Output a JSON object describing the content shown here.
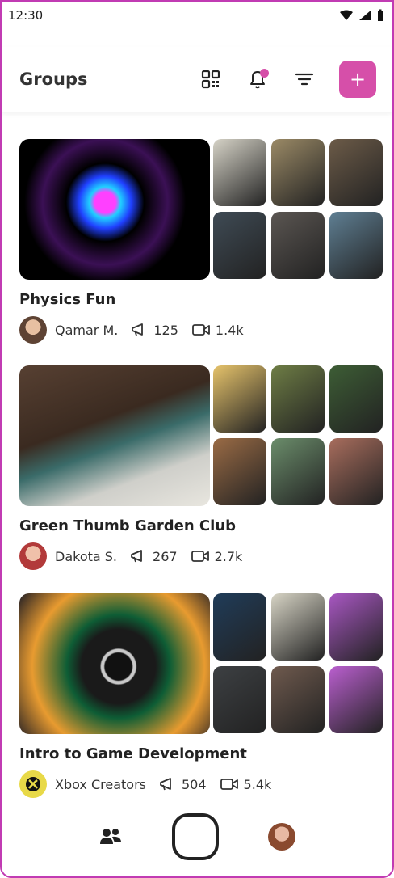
{
  "status": {
    "time": "12:30"
  },
  "header": {
    "title": "Groups",
    "add_label": "+"
  },
  "groups": [
    {
      "name": "Physics Fun",
      "owner": "Qamar M.",
      "posts": "125",
      "videos": "1.4k",
      "colors": [
        "#d6d3c7",
        "#9b8a66",
        "#6c5b48",
        "#3f4b55",
        "#5b5652",
        "#5f7f93"
      ]
    },
    {
      "name": "Green Thumb Garden Club",
      "owner": "Dakota S.",
      "posts": "267",
      "videos": "2.7k",
      "colors": [
        "#e6c36b",
        "#6e7d45",
        "#3d5d35",
        "#9a6b45",
        "#6b8d6b",
        "#a86d5d"
      ]
    },
    {
      "name": "Intro to Game Development",
      "owner": "Xbox Creators",
      "posts": "504",
      "videos": "5.4k",
      "colors": [
        "#203c59",
        "#d7d4c5",
        "#a857c2",
        "#3d4043",
        "#6f5a4e",
        "#ba5fcf"
      ]
    }
  ]
}
